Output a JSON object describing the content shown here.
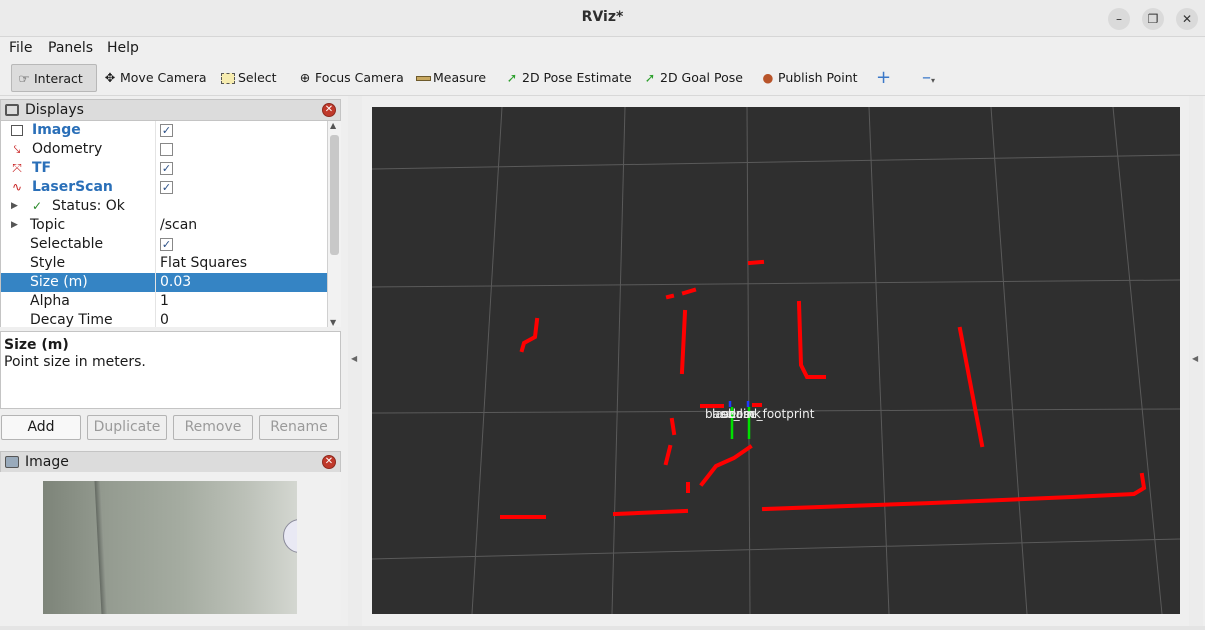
{
  "window": {
    "title": "RViz*"
  },
  "menu": [
    "File",
    "Panels",
    "Help"
  ],
  "toolbar": {
    "interact": "Interact",
    "move_camera": "Move Camera",
    "select": "Select",
    "focus_camera": "Focus Camera",
    "measure": "Measure",
    "pose_estimate": "2D Pose Estimate",
    "goal_pose": "2D Goal Pose",
    "publish_point": "Publish Point"
  },
  "displays_panel": {
    "title": "Displays",
    "rows": [
      {
        "name": "Image",
        "checked": true,
        "icon": "image-icon"
      },
      {
        "name": "Odometry",
        "checked": false,
        "icon": "odometry-icon"
      },
      {
        "name": "TF",
        "checked": true,
        "icon": "tf-icon"
      },
      {
        "name": "LaserScan",
        "checked": true,
        "icon": "laserscan-icon"
      },
      {
        "name": "Status: Ok"
      },
      {
        "name": "Topic",
        "value": "/scan"
      },
      {
        "name": "Selectable",
        "checked": true
      },
      {
        "name": "Style",
        "value": "Flat Squares"
      },
      {
        "name": "Size (m)",
        "value": "0.03"
      },
      {
        "name": "Alpha",
        "value": "1"
      },
      {
        "name": "Decay Time",
        "value": "0"
      }
    ],
    "description": {
      "title": "Size (m)",
      "text": "Point size in meters."
    },
    "buttons": {
      "add": "Add",
      "duplicate": "Duplicate",
      "remove": "Remove",
      "rename": "Rename"
    }
  },
  "image_panel": {
    "title": "Image"
  },
  "viewport": {
    "frame_labels": [
      "base_link",
      "laser",
      "odom",
      "base_footprint"
    ],
    "colors": {
      "background": "#2f2f2f",
      "grid": "#5a5a5a",
      "scan": "#ff0000"
    }
  }
}
